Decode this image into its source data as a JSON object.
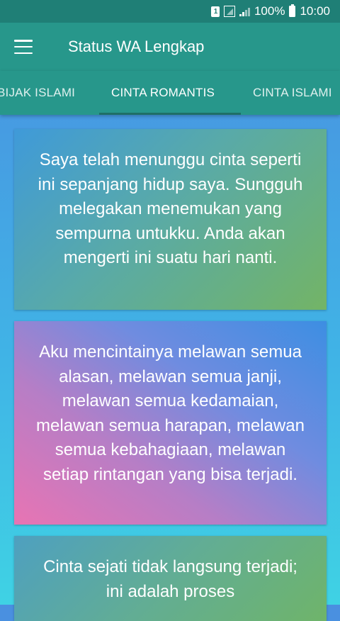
{
  "status_bar": {
    "sim_label": "1",
    "battery_percent": "100%",
    "time": "10:00",
    "icons": [
      "sim-icon",
      "signal-icon",
      "cell-bars-icon",
      "battery-icon"
    ]
  },
  "app_bar": {
    "title": "Status WA Lengkap",
    "menu_icon": "hamburger-menu-icon",
    "background": "#27978b"
  },
  "tabs": [
    {
      "label": "BIJAK ISLAMI",
      "selected": false
    },
    {
      "label": "CINTA ROMANTIS",
      "selected": true
    },
    {
      "label": "CINTA ISLAMI",
      "selected": false
    }
  ],
  "cards": [
    {
      "text": "Saya telah menunggu cinta seperti ini sepanjang hidup saya. Sungguh melegakan menemukan yang sempurna untukku. Anda akan mengerti ini suatu hari nanti."
    },
    {
      "text": "Aku mencintainya melawan semua alasan, melawan semua janji, melawan semua kedamaian, melawan semua harapan, melawan semua kebahagiaan, melawan setiap rintangan yang bisa terjadi."
    },
    {
      "text": "Cinta sejati tidak langsung terjadi; ini adalah proses"
    }
  ]
}
